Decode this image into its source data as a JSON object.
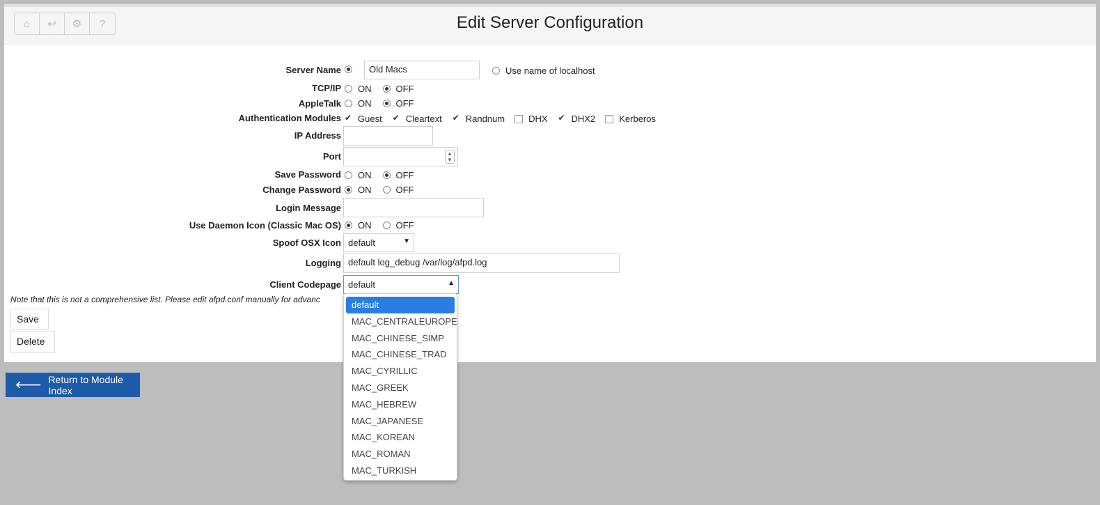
{
  "page": {
    "title": "Edit Server Configuration"
  },
  "toolbar": {
    "buttons": [
      {
        "icon": "home-icon",
        "glyph": "⌂"
      },
      {
        "icon": "back-arrow-icon",
        "glyph": "↩"
      },
      {
        "icon": "gear-icon",
        "glyph": "⚙"
      },
      {
        "icon": "help-icon",
        "glyph": "?"
      }
    ]
  },
  "form": {
    "server_name": {
      "label": "Server Name",
      "value": "Old Macs",
      "alt_label": "Use name of localhost"
    },
    "tcpip": {
      "label": "TCP/IP",
      "on": "ON",
      "off": "OFF",
      "selected": "OFF"
    },
    "appletalk": {
      "label": "AppleTalk",
      "on": "ON",
      "off": "OFF",
      "selected": "OFF"
    },
    "auth_modules": {
      "label": "Authentication Modules",
      "options": [
        {
          "label": "Guest",
          "checked": true
        },
        {
          "label": "Cleartext",
          "checked": true
        },
        {
          "label": "Randnum",
          "checked": true
        },
        {
          "label": "DHX",
          "checked": false
        },
        {
          "label": "DHX2",
          "checked": true
        },
        {
          "label": "Kerberos",
          "checked": false
        }
      ]
    },
    "ip_address": {
      "label": "IP Address",
      "value": ""
    },
    "port": {
      "label": "Port",
      "value": ""
    },
    "save_password": {
      "label": "Save Password",
      "on": "ON",
      "off": "OFF",
      "selected": "OFF"
    },
    "change_password": {
      "label": "Change Password",
      "on": "ON",
      "off": "OFF",
      "selected": "ON"
    },
    "login_message": {
      "label": "Login Message",
      "value": ""
    },
    "daemon_icon": {
      "label": "Use Daemon Icon (Classic Mac OS)",
      "on": "ON",
      "off": "OFF",
      "selected": "ON"
    },
    "spoof_osx_icon": {
      "label": "Spoof OSX Icon",
      "value": "default"
    },
    "logging": {
      "label": "Logging",
      "value": "default log_debug /var/log/afpd.log"
    },
    "client_codepage": {
      "label": "Client Codepage",
      "value": "default",
      "options": [
        "default",
        "MAC_CENTRALEUROPE",
        "MAC_CHINESE_SIMP",
        "MAC_CHINESE_TRAD",
        "MAC_CYRILLIC",
        "MAC_GREEK",
        "MAC_HEBREW",
        "MAC_JAPANESE",
        "MAC_KOREAN",
        "MAC_ROMAN",
        "MAC_TURKISH"
      ]
    }
  },
  "note": "Note that this is not a comprehensive list. Please edit afpd.conf manually for advanc",
  "buttons": {
    "save": "Save",
    "delete": "Delete"
  },
  "footer": {
    "return_label": "Return to Module Index"
  },
  "colors": {
    "accent": "#1e5bab",
    "selected_option": "#2a7de1",
    "background": "#bdbdbd"
  }
}
